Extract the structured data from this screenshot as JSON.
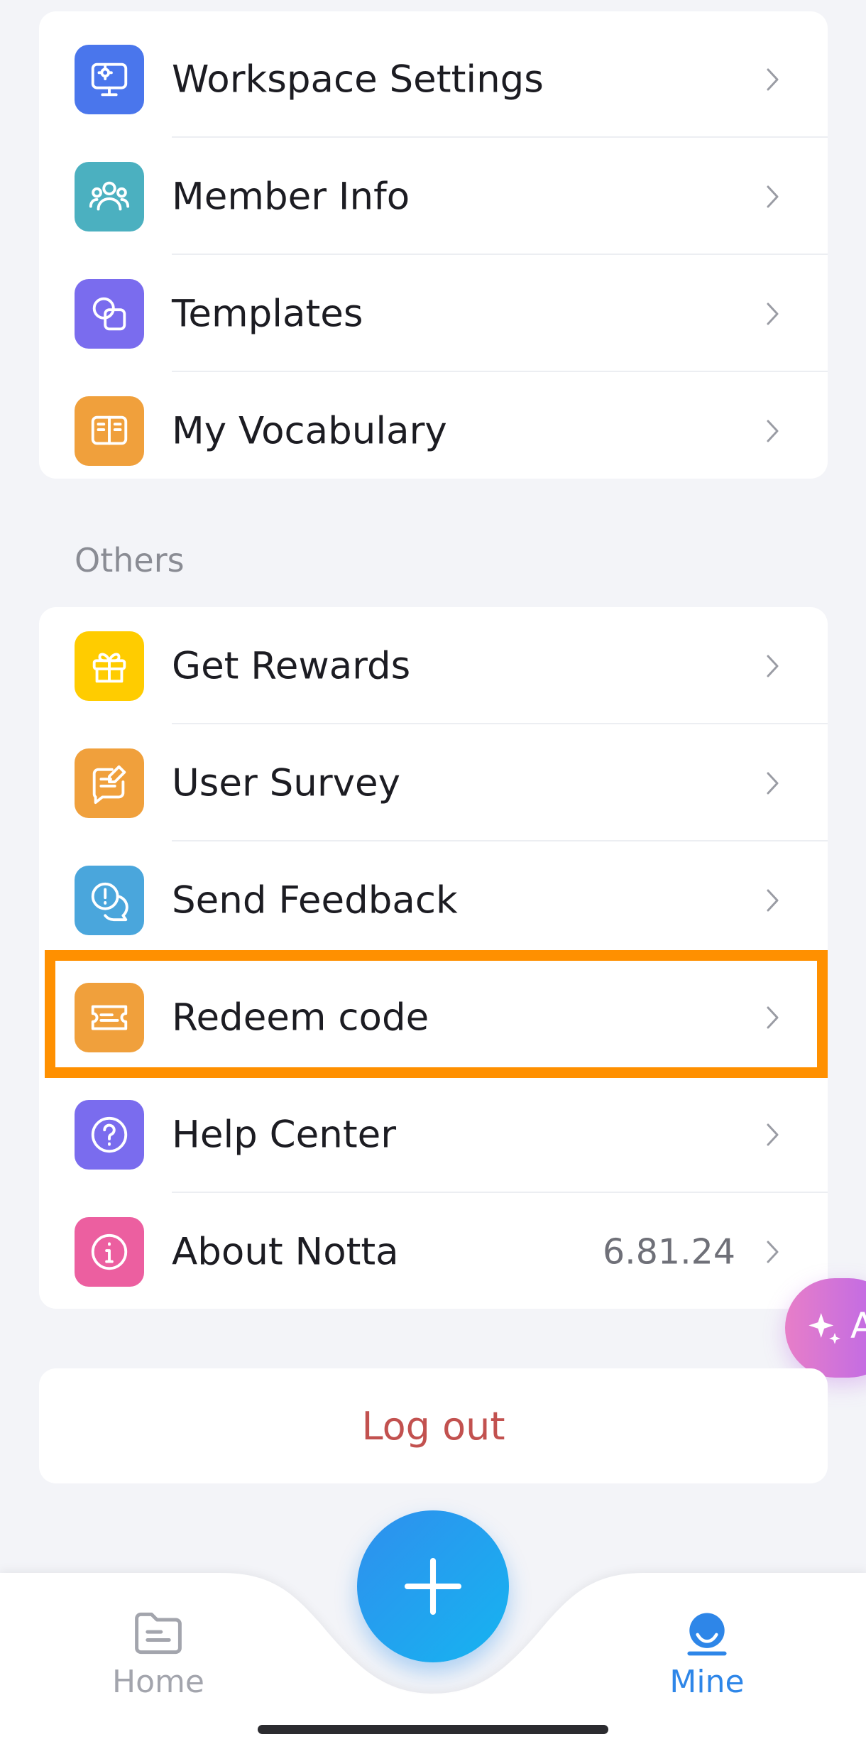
{
  "workspace_section": {
    "items": [
      {
        "label": "Workspace Settings",
        "icon": "monitor-gear-icon",
        "color": "#4a76ec"
      },
      {
        "label": "Member Info",
        "icon": "people-icon",
        "color": "#4bb0c0"
      },
      {
        "label": "Templates",
        "icon": "overlapping-shapes-icon",
        "color": "#7a6cee"
      },
      {
        "label": "My Vocabulary",
        "icon": "open-book-icon",
        "color": "#f0a03c"
      }
    ]
  },
  "others_section": {
    "title": "Others",
    "items": [
      {
        "label": "Get Rewards",
        "icon": "gift-icon",
        "color": "#ffcc00"
      },
      {
        "label": "User Survey",
        "icon": "survey-edit-icon",
        "color": "#f0a03c"
      },
      {
        "label": "Send Feedback",
        "icon": "feedback-bubbles-icon",
        "color": "#4aa6dc"
      },
      {
        "label": "Redeem code",
        "icon": "ticket-icon",
        "color": "#f0a03c",
        "highlighted": true
      },
      {
        "label": "Help Center",
        "icon": "question-circle-icon",
        "color": "#7a6cee"
      },
      {
        "label": "About Notta",
        "icon": "info-circle-icon",
        "color": "#ec5fa0",
        "value": "6.81.24"
      }
    ]
  },
  "ai_button": {
    "label": "A",
    "icon": "sparkle-icon"
  },
  "logout": {
    "label": "Log out",
    "color": "#c2514f"
  },
  "tabbar": {
    "home": {
      "label": "Home",
      "icon": "folder-icon"
    },
    "mine": {
      "label": "Mine",
      "icon": "user-icon",
      "active": true
    },
    "add_icon": "plus-icon"
  },
  "colors": {
    "accent": "#2e86e8",
    "highlight": "#ff9000"
  }
}
